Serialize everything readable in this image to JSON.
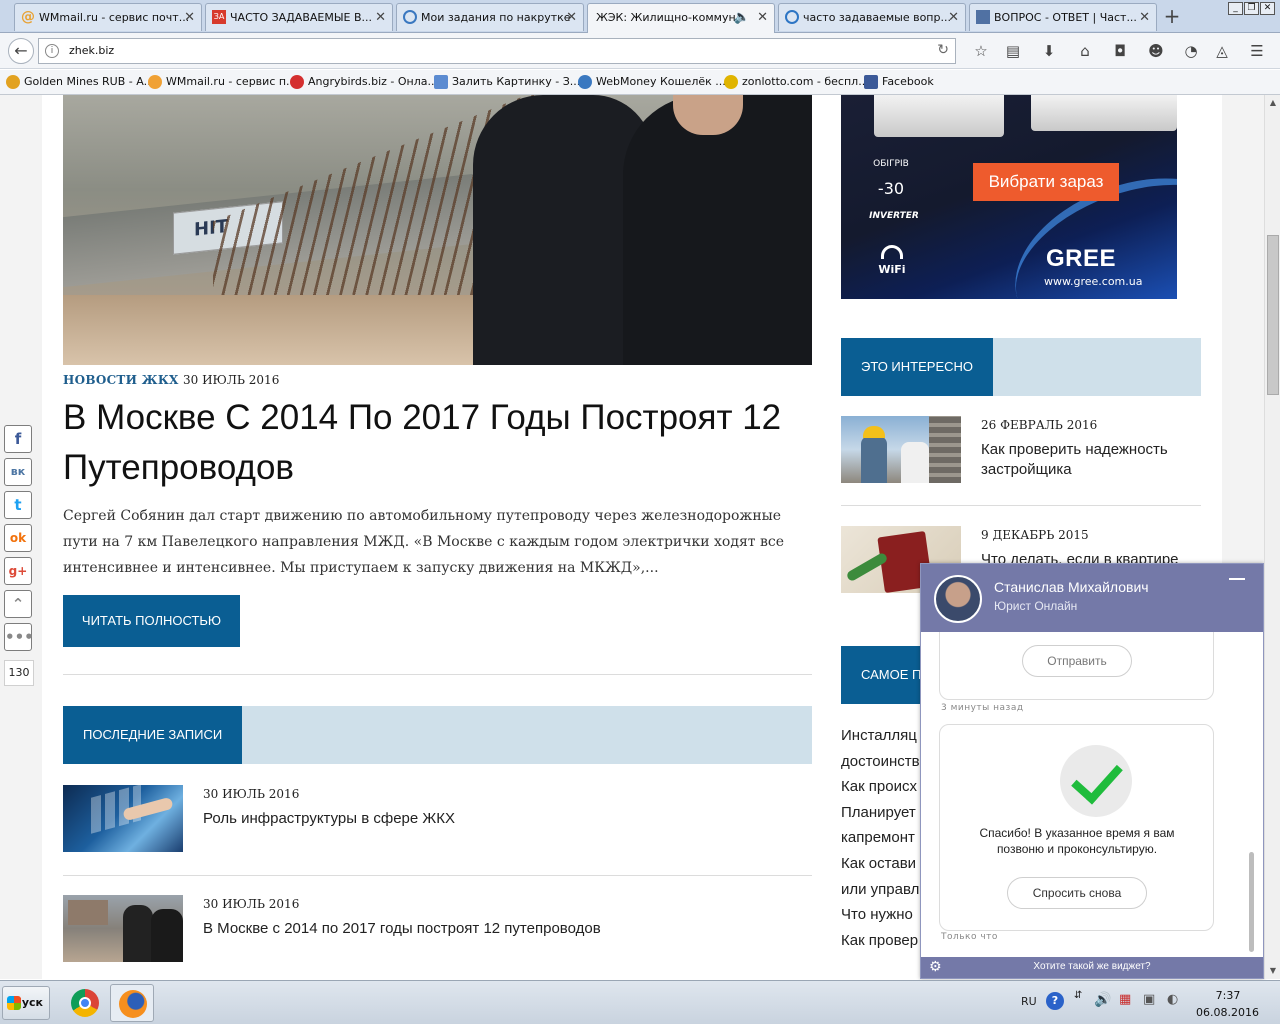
{
  "browser": {
    "tabs": [
      {
        "title": "WMmail.ru - сервис почт...",
        "icon_color": "#e8a235",
        "icon": "at-icon"
      },
      {
        "title": "ЧАСТО ЗАДАВАЕМЫЕ В...",
        "icon_color": "#d73a2c",
        "icon": "za-icon"
      },
      {
        "title": "Мои задания по накрутке",
        "icon_color": "#3a78c0",
        "icon": "spiral-icon"
      },
      {
        "title": "ЖЭК: Жилищно-коммун...",
        "icon_color": "#ffffff",
        "icon": "blank-icon"
      },
      {
        "title": "часто задаваемые вопр...",
        "icon_color": "#2d75c4",
        "icon": "search-icon"
      },
      {
        "title": "ВОПРОС - ОТВЕТ | Част...",
        "icon_color": "#5071a3",
        "icon": "page-icon"
      }
    ],
    "url": "zhek.biz",
    "bookmarks": [
      {
        "label": "Golden Mines RUB - A...",
        "color": "#e2a221"
      },
      {
        "label": "WMmail.ru - сервис п...",
        "color": "#f0a135"
      },
      {
        "label": "Angrybirds.biz - Онла...",
        "color": "#d42f2f"
      },
      {
        "label": "Залить Картинку - З...",
        "color": "#5b8bd1"
      },
      {
        "label": "WebMoney Кошелёк ...",
        "color": "#3a78c0"
      },
      {
        "label": "zonlotto.com - беспл...",
        "color": "#e0b400"
      },
      {
        "label": "Facebook",
        "color": "#3b5998"
      }
    ]
  },
  "main": {
    "category": "НОВОСТИ ЖКХ",
    "date": "30 ИЮЛЬ 2016",
    "headline": "В Москве С 2014 По 2017 Годы Построят 12 Путепроводов",
    "excerpt": "Сергей Собянин дал старт движению по автомобильному путепроводу через железнодорожные пути на 7 км Павелецкого направления МЖД. «В Москве с каждым годом электрички ходят все интенсивнее и интенсивнее. Мы приступаем к запуску движения на МКЖД»,...",
    "read_more": "ЧИТАТЬ ПОЛНОСТЬЮ",
    "hero_truck_text": "НIТ",
    "recent_title": "ПОСЛЕДНИЕ ЗАПИСИ",
    "recent": [
      {
        "date": "30 ИЮЛЬ 2016",
        "title": "Роль инфраструктуры в сфере ЖКХ"
      },
      {
        "date": "30 ИЮЛЬ 2016",
        "title": "В Москве с 2014 по 2017 годы построят 12 путепроводов"
      }
    ]
  },
  "sidebar": {
    "ad": {
      "cta": "Вибрати зараз",
      "heat_label": "ОБІГРІВ",
      "heat_value": "-30",
      "inverter": "INVERTER",
      "wifi": "WiFi",
      "brand": "GREE",
      "url": "www.gree.com.ua"
    },
    "interesting_title": "ЭТО ИНТЕРЕСНО",
    "interesting": [
      {
        "date": "26 ФЕВРАЛЬ 2016",
        "title": "Как проверить надежность застройщика"
      },
      {
        "date": "9 ДЕКАБРЬ 2015",
        "title": "Что делать, если в квартире"
      }
    ],
    "popular_title": "САМОЕ П",
    "popular_links": [
      "Инсталляц",
      "достоинств",
      "Как происх",
      "Планирует",
      "капремонт",
      "Как остави",
      "или управл",
      "Что нужно",
      "Как провер"
    ]
  },
  "social": {
    "buttons": [
      "f",
      "вк",
      "t",
      "ok",
      "g+",
      "up",
      "more"
    ],
    "count": "130"
  },
  "chat": {
    "agent_name": "Станислав Михайлович",
    "agent_role": "Юрист Онлайн",
    "send_label": "Отправить",
    "sent_meta": "3 минуты назад",
    "thanks": "Спасибо! В указанное время я вам позвоню и проконсультирую.",
    "ask_again": "Спросить снова",
    "just_now": "Только что",
    "footer": "Хотите такой же виджет?"
  },
  "taskbar": {
    "start": "Пуск",
    "lang": "RU",
    "time": "7:37",
    "date": "06.08.2016"
  }
}
